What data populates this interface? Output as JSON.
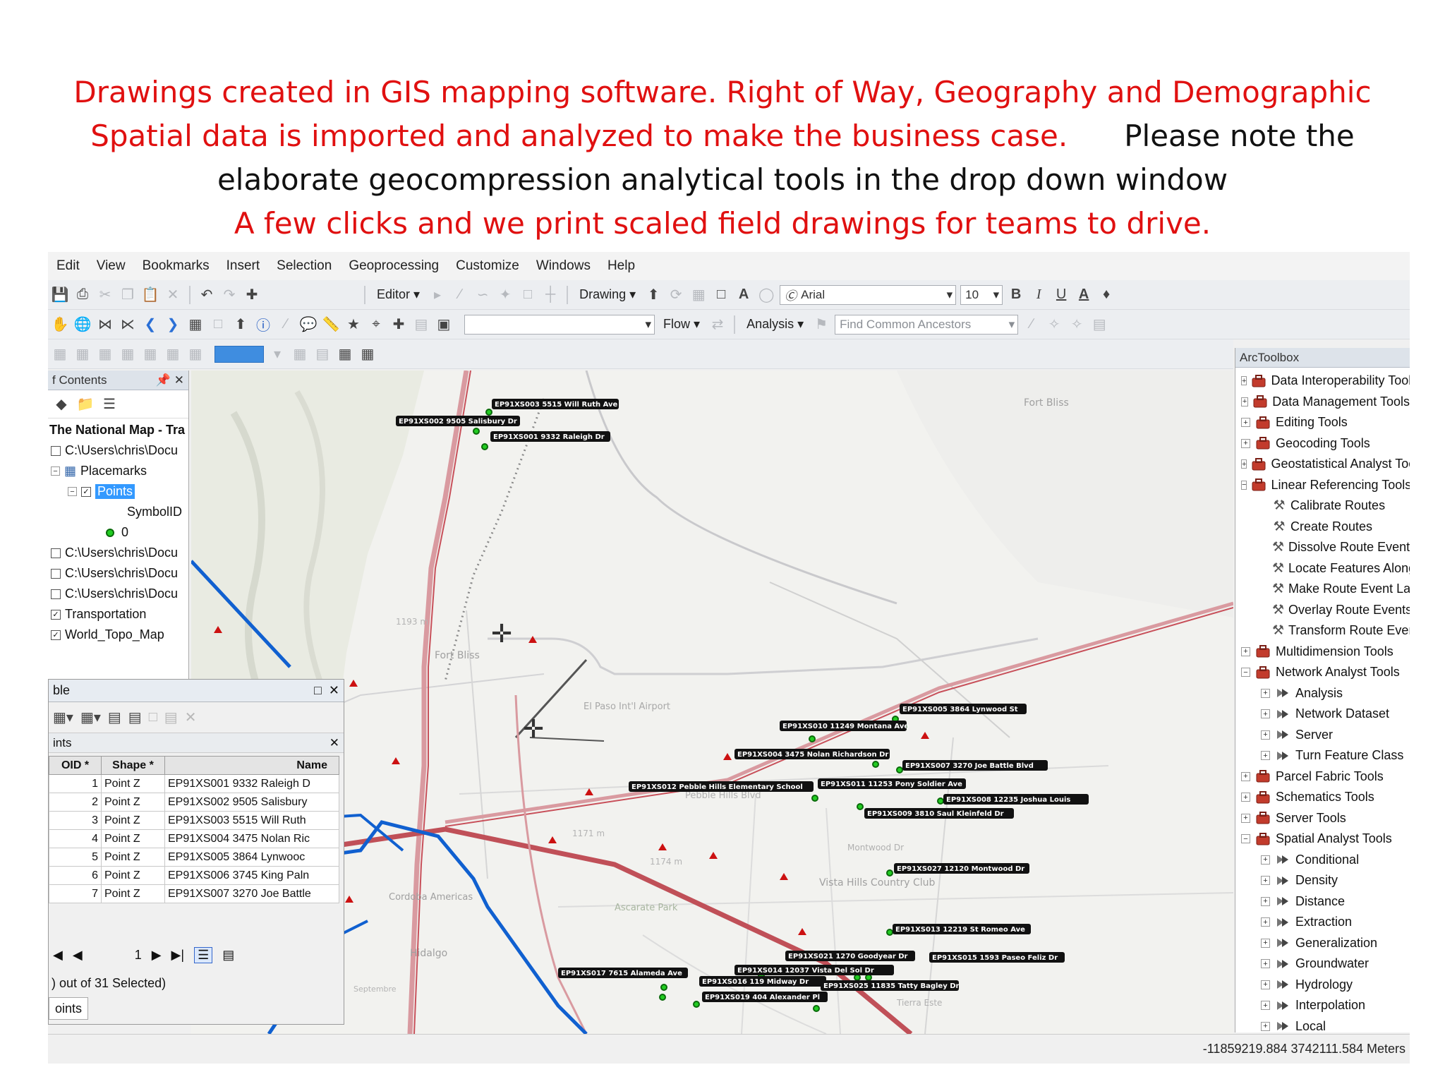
{
  "caption": {
    "line1": "Drawings created in GIS mapping software. Right of Way, Geography and Demographic",
    "line2_red": "Spatial data is imported and analyzed to make the business case.",
    "line2_black": "Please note the",
    "line3": "elaborate geocompression analytical tools in the drop down window",
    "line4": "A few clicks and we print scaled field drawings for teams to drive",
    "line4_period": "."
  },
  "menu": [
    "Edit",
    "View",
    "Bookmarks",
    "Insert",
    "Selection",
    "Geoprocessing",
    "Customize",
    "Windows",
    "Help"
  ],
  "toolbar": {
    "editor_label": "Editor",
    "drawing_label": "Drawing",
    "font_name": "Arial",
    "font_size": "10",
    "bold": "B",
    "italic": "I",
    "underline": "U",
    "color_a": "A",
    "flow_label": "Flow",
    "analysis_label": "Analysis",
    "find_common_ancestors": "Find Common Ancestors"
  },
  "toc": {
    "title": "f Contents",
    "pin": "⮌",
    "close": "✕",
    "rows": [
      {
        "text": "The National Map - Tra",
        "type": "header"
      },
      {
        "text": "C:\\Users\\chris\\Docu",
        "type": "layer"
      },
      {
        "text": "Placemarks",
        "type": "group"
      },
      {
        "text": "Points",
        "type": "checked-selected"
      },
      {
        "text": "SymbolID",
        "type": "legend-title"
      },
      {
        "text": "0",
        "type": "legend-item"
      },
      {
        "text": "C:\\Users\\chris\\Docu",
        "type": "layer"
      },
      {
        "text": "C:\\Users\\chris\\Docu",
        "type": "layer"
      },
      {
        "text": "C:\\Users\\chris\\Docu",
        "type": "layer"
      },
      {
        "text": "Transportation",
        "type": "checked"
      },
      {
        "text": "World_Topo_Map",
        "type": "checked"
      }
    ]
  },
  "table_window": {
    "title": "ble",
    "tab_name": "ints",
    "columns": [
      "OID *",
      "Shape *",
      "Name"
    ],
    "rows": [
      [
        "1",
        "Point Z",
        "EP91XS001 9332 Raleigh D"
      ],
      [
        "2",
        "Point Z",
        "EP91XS002 9505 Salisbury"
      ],
      [
        "3",
        "Point Z",
        "EP91XS003 5515 Will Ruth"
      ],
      [
        "4",
        "Point Z",
        "EP91XS004 3475 Nolan Ric"
      ],
      [
        "5",
        "Point Z",
        "EP91XS005 3864 Lynwooc"
      ],
      [
        "6",
        "Point Z",
        "EP91XS006 3745 King Paln"
      ],
      [
        "7",
        "Point Z",
        "EP91XS007 3270 Joe Battle"
      ]
    ],
    "page": "1",
    "status": ") out of 31 Selected)",
    "tab_button": "oints"
  },
  "toolbox": {
    "title": "ArcToolbox",
    "items": [
      {
        "text": "Data Interoperability Tools",
        "level": 0,
        "kind": "toolbox",
        "expander": "+"
      },
      {
        "text": "Data Management Tools",
        "level": 0,
        "kind": "toolbox",
        "expander": "+"
      },
      {
        "text": "Editing Tools",
        "level": 0,
        "kind": "toolbox",
        "expander": "+"
      },
      {
        "text": "Geocoding Tools",
        "level": 0,
        "kind": "toolbox",
        "expander": "+"
      },
      {
        "text": "Geostatistical Analyst Tools",
        "level": 0,
        "kind": "toolbox",
        "expander": "+"
      },
      {
        "text": "Linear Referencing Tools",
        "level": 0,
        "kind": "toolbox",
        "expander": "-"
      },
      {
        "text": "Calibrate Routes",
        "level": 1,
        "kind": "tool",
        "expander": ""
      },
      {
        "text": "Create Routes",
        "level": 1,
        "kind": "tool",
        "expander": ""
      },
      {
        "text": "Dissolve Route Events",
        "level": 1,
        "kind": "tool",
        "expander": ""
      },
      {
        "text": "Locate Features Along Rout",
        "level": 1,
        "kind": "tool",
        "expander": ""
      },
      {
        "text": "Make Route Event Layer",
        "level": 1,
        "kind": "tool",
        "expander": ""
      },
      {
        "text": "Overlay Route Events",
        "level": 1,
        "kind": "tool",
        "expander": ""
      },
      {
        "text": "Transform Route Events",
        "level": 1,
        "kind": "tool",
        "expander": ""
      },
      {
        "text": "Multidimension Tools",
        "level": 0,
        "kind": "toolbox",
        "expander": "+"
      },
      {
        "text": "Network Analyst Tools",
        "level": 0,
        "kind": "toolbox",
        "expander": "-"
      },
      {
        "text": "Analysis",
        "level": 1,
        "kind": "toolset",
        "expander": "+"
      },
      {
        "text": "Network Dataset",
        "level": 1,
        "kind": "toolset",
        "expander": "+"
      },
      {
        "text": "Server",
        "level": 1,
        "kind": "toolset",
        "expander": "+"
      },
      {
        "text": "Turn Feature Class",
        "level": 1,
        "kind": "toolset",
        "expander": "+"
      },
      {
        "text": "Parcel Fabric Tools",
        "level": 0,
        "kind": "toolbox",
        "expander": "+"
      },
      {
        "text": "Schematics Tools",
        "level": 0,
        "kind": "toolbox",
        "expander": "+"
      },
      {
        "text": "Server Tools",
        "level": 0,
        "kind": "toolbox",
        "expander": "+"
      },
      {
        "text": "Spatial Analyst Tools",
        "level": 0,
        "kind": "toolbox",
        "expander": "-"
      },
      {
        "text": "Conditional",
        "level": 1,
        "kind": "toolset",
        "expander": "+"
      },
      {
        "text": "Density",
        "level": 1,
        "kind": "toolset",
        "expander": "+"
      },
      {
        "text": "Distance",
        "level": 1,
        "kind": "toolset",
        "expander": "+"
      },
      {
        "text": "Extraction",
        "level": 1,
        "kind": "toolset",
        "expander": "+"
      },
      {
        "text": "Generalization",
        "level": 1,
        "kind": "toolset",
        "expander": "+"
      },
      {
        "text": "Groundwater",
        "level": 1,
        "kind": "toolset",
        "expander": "+"
      },
      {
        "text": "Hydrology",
        "level": 1,
        "kind": "toolset",
        "expander": "+"
      },
      {
        "text": "Interpolation",
        "level": 1,
        "kind": "toolset",
        "expander": "+"
      },
      {
        "text": "Local",
        "level": 1,
        "kind": "toolset",
        "expander": "+"
      }
    ]
  },
  "map": {
    "place_labels": [
      "Fort Bliss",
      "Fort Bliss",
      "El Paso Int'l Airport",
      "Pebble Hills Blvd",
      "Vista Hills Country Club",
      "Ascarate Park",
      "Cordoba Americas",
      "Hidalgo",
      "Montwood Dr",
      "Tierra Este",
      "1171 m",
      "1174 m",
      "1193 m",
      "Septembre"
    ],
    "point_labels": [
      "EP91XS003 5515 Will Ruth Ave",
      "EP91XS002 9505 Salisbury Dr",
      "EP91XS001 9332 Raleigh Dr",
      "EP91XS005 3864 Lynwood St",
      "EP91XS010 11249 Montana Ave",
      "EP91XS004 3475 Nolan Richardson Dr",
      "EP91XS007 3270 Joe Battle Blvd",
      "EP91XS012 Pebble Hills Elementary School",
      "EP91XS011 11253 Pony Soldier Ave",
      "EP91XS008 12235 Joshua Louis",
      "EP91XS009 3810 Saul Kleinfeld Dr",
      "EP91XS027 12120 Montwood Dr",
      "EP91XS013 12219 St Romeo Ave",
      "EP91XS021 1270 Goodyear Dr",
      "EP91XS015 1593 Paseo Feliz Dr",
      "EP91XS017 7615 Alameda Ave",
      "EP91XS016 119 Midway Dr",
      "EP91XS014 12037 Vista Del Sol Dr",
      "EP91XS019 404 Alexander Pl",
      "EP91XS025 11835 Tatty Bagley Dr"
    ],
    "colors": {
      "road_red": "#c8505a",
      "route_blue": "#1060d0",
      "point_green": "#22cc22",
      "triangle_red": "#cc1111"
    }
  },
  "status": {
    "coordinates": "-11859219.884  3742111.584 Meters"
  }
}
